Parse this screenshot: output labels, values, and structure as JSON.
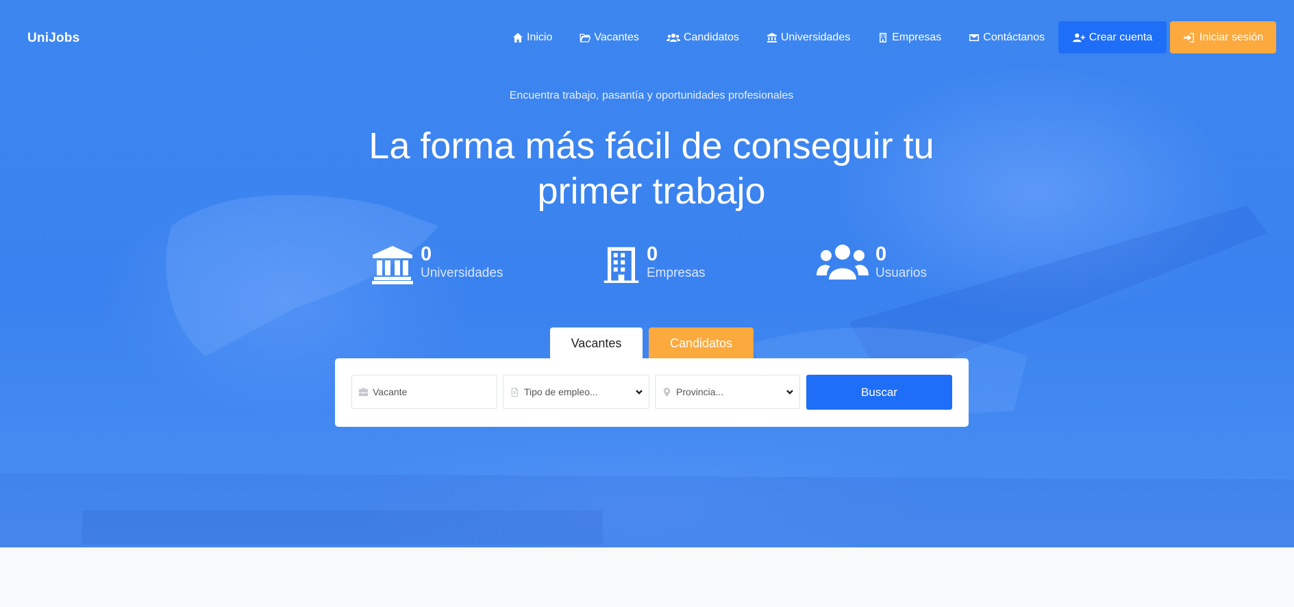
{
  "brand": {
    "name": "UniJobs"
  },
  "nav": {
    "links": [
      {
        "label": "Inicio",
        "icon": "home-icon"
      },
      {
        "label": "Vacantes",
        "icon": "folder-open-icon"
      },
      {
        "label": "Candidatos",
        "icon": "users-icon"
      },
      {
        "label": "Universidades",
        "icon": "university-icon"
      },
      {
        "label": "Empresas",
        "icon": "building-icon"
      },
      {
        "label": "Contáctanos",
        "icon": "envelope-icon"
      }
    ],
    "create_account": "Crear cuenta",
    "login": "Iniciar sesión"
  },
  "hero": {
    "tagline": "Encuentra trabajo, pasantía y oportunidades profesionales",
    "headline_line1": "La forma más fácil de conseguir tu",
    "headline_line2": "primer trabajo"
  },
  "stats": [
    {
      "value": "0",
      "label": "Universidades",
      "icon": "university-icon"
    },
    {
      "value": "0",
      "label": "Empresas",
      "icon": "building-icon"
    },
    {
      "value": "0",
      "label": "Usuarios",
      "icon": "users-icon"
    }
  ],
  "tabs": {
    "vacantes": "Vacantes",
    "candidatos": "Candidatos"
  },
  "search": {
    "vacancy_placeholder": "Vacante",
    "job_type_selected": "Tipo de empleo...",
    "province_selected": "Provincia...",
    "button": "Buscar"
  },
  "colors": {
    "primary": "#1f6ef7",
    "accent": "#fca93e",
    "hero_bg": "#3d86f0"
  }
}
